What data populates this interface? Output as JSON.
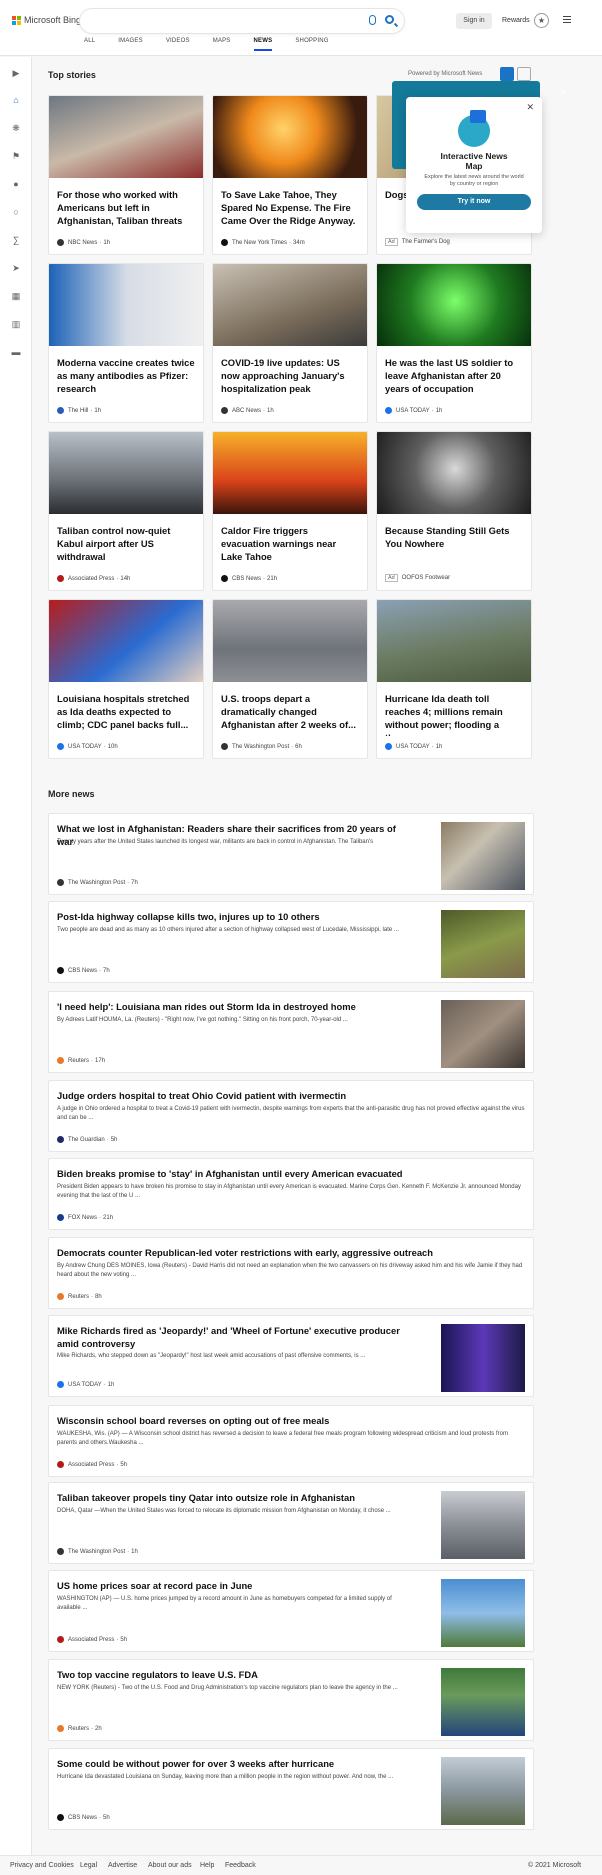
{
  "header": {
    "brand": "Microsoft Bing",
    "search_value": "",
    "signin_label": "Sign in",
    "rewards_label": "Rewards",
    "nav_tabs": [
      "ALL",
      "IMAGES",
      "VIDEOS",
      "MAPS",
      "NEWS",
      "SHOPPING"
    ],
    "active_tab": "NEWS"
  },
  "top_stories": {
    "title": "Top stories",
    "powered_by": "Powered by Microsoft News",
    "cards": [
      {
        "title": "For those who worked with Americans but left in Afghanistan, Taliban threats a...",
        "source": "NBC News",
        "time": "1h"
      },
      {
        "title": "To Save Lake Tahoe, They Spared No Expense. The Fire Came Over the Ridge Anyway.",
        "source": "The New York Times",
        "time": "34m"
      },
      {
        "title": "Dogs brow",
        "source": "The Farmer's Dog",
        "ad": "Ad"
      },
      {
        "title": "Moderna vaccine creates twice as many antibodies as Pfizer: research",
        "source": "The Hill",
        "time": "1h"
      },
      {
        "title": "COVID-19 live updates: US now approaching January's hospitalization peak",
        "source": "ABC News",
        "time": "1h"
      },
      {
        "title": "He was the last US soldier to leave Afghanistan after 20 years of occupation",
        "source": "USA TODAY",
        "time": "1h"
      },
      {
        "title": "Taliban control now-quiet Kabul airport after US withdrawal",
        "source": "Associated Press",
        "time": "14h"
      },
      {
        "title": "Caldor Fire triggers evacuation warnings near Lake Tahoe",
        "source": "CBS News",
        "time": "21h"
      },
      {
        "title": "Because Standing Still Gets You Nowhere",
        "source": "OOFOS Footwear",
        "ad": "Ad"
      },
      {
        "title": "Louisiana hospitals stretched as Ida deaths expected to climb; CDC panel backs full...",
        "source": "USA TODAY",
        "time": "10h"
      },
      {
        "title": "U.S. troops depart a dramatically changed Afghanistan after 2 weeks of...",
        "source": "The Washington Post",
        "time": "6h"
      },
      {
        "title": "Hurricane Ida death toll reaches 4; millions remain without power; flooding a thre...",
        "source": "USA TODAY",
        "time": "1h"
      }
    ]
  },
  "popup": {
    "title": "Interactive News Map",
    "description": "Explore the latest news around the world by country or region",
    "button": "Try it now"
  },
  "more_news": {
    "title": "More news",
    "items": [
      {
        "title": "What we lost in Afghanistan: Readers share their sacrifices from 20 years of war",
        "snippet": "Twenty years after the United States launched its longest war, militants are back in control in Afghanistan. The Taliban's",
        "source": "The Washington Post",
        "time": "7h"
      },
      {
        "title": "Post-Ida highway collapse kills two, injures up to 10 others",
        "snippet": "Two people are dead and as many as 10 others injured after a section of highway collapsed west of Lucedale, Mississippi, late ...",
        "source": "CBS News",
        "time": "7h"
      },
      {
        "title": "'I need help': Louisiana man rides out Storm Ida in destroyed home",
        "snippet": "By Adrees Latif HOUMA, La. (Reuters) - \"Right now, I've got nothing.\" Sitting on his front porch, 70-year-old ...",
        "source": "Reuters",
        "time": "17h"
      },
      {
        "title": "Judge orders hospital to treat Ohio Covid patient with ivermectin",
        "snippet": "A judge in Ohio ordered a hospital to treat a Covid-19 patient with ivermectin, despite warnings from experts that the anti-parasitic drug has not proved effective against the virus and can be ...",
        "source": "The Guardian",
        "time": "5h"
      },
      {
        "title": "Biden breaks promise to 'stay' in Afghanistan until every American evacuated",
        "snippet": "President Biden appears to have broken his promise to stay in Afghanistan until every American is evacuated. Marine Corps Gen. Kenneth F. McKenzie Jr. announced Monday evening that the last of the U ...",
        "source": "FOX News",
        "time": "21h"
      },
      {
        "title": "Democrats counter Republican-led voter restrictions with early, aggressive outreach",
        "snippet": "By Andrew Chung DES MOINES, Iowa (Reuters) - David Harris did not need an explanation when the two canvassers on his driveway asked him and his wife Jamie if they had heard about the new voting ...",
        "source": "Reuters",
        "time": "8h"
      },
      {
        "title": "Mike Richards fired as 'Jeopardy!' and 'Wheel of Fortune' executive producer amid controversy",
        "snippet": "Mike Richards, who stepped down as \"Jeopardy!\" host last week amid accusations of past offensive comments, is ...",
        "source": "USA TODAY",
        "time": "1h"
      },
      {
        "title": "Wisconsin school board reverses on opting out of free meals",
        "snippet": "WAUKESHA, Wis. (AP) — A Wisconsin school district has reversed a decision to leave a federal free meals program following widespread criticism and loud protests from parents and others.Waukesha ...",
        "source": "Associated Press",
        "time": "5h"
      },
      {
        "title": "Taliban takeover propels tiny Qatar into outsize role in Afghanistan",
        "snippet": "DOHA, Qatar —When the United States was forced to relocate its diplomatic mission from Afghanistan on Monday, it chose ...",
        "source": "The Washington Post",
        "time": "1h"
      },
      {
        "title": "US home prices soar at record pace in June",
        "snippet": "WASHINGTON (AP) — U.S. home prices jumped by a record amount in June as homebuyers competed for a limited supply of available ...",
        "source": "Associated Press",
        "time": "5h"
      },
      {
        "title": "Two top vaccine regulators to leave U.S. FDA",
        "snippet": "NEW YORK (Reuters) - Two of the U.S. Food and Drug Administration's top vaccine regulators plan to leave the agency in the ...",
        "source": "Reuters",
        "time": "2h"
      },
      {
        "title": "Some could be without power for over 3 weeks after hurricane",
        "snippet": "Hurricane Ida devastated Louisiana on Sunday, leaving more than a million people in the region without power. And now, the ...",
        "source": "CBS News",
        "time": "5h"
      }
    ]
  },
  "footer": {
    "links": [
      "Privacy and Cookies",
      "Legal",
      "Advertise",
      "About our ads",
      "Help",
      "Feedback"
    ],
    "copyright": "© 2021 Microsoft"
  }
}
